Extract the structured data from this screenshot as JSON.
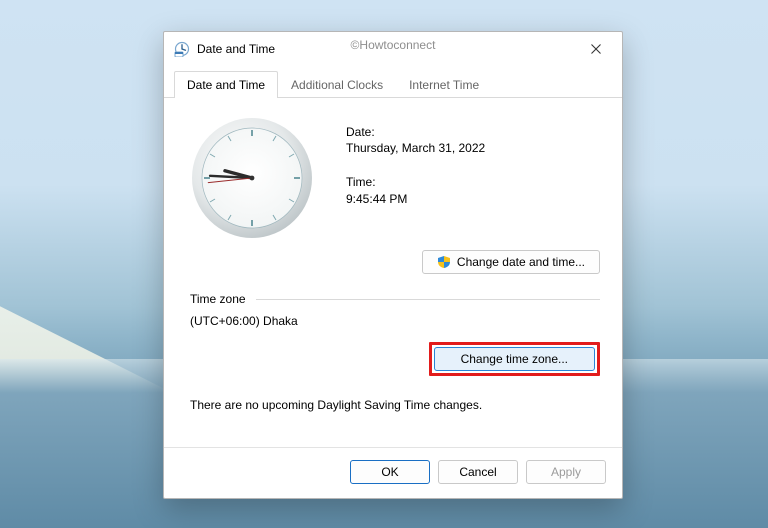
{
  "watermark": "©Howtoconnect",
  "window": {
    "title": "Date and Time"
  },
  "tabs": [
    {
      "label": "Date and Time",
      "active": true
    },
    {
      "label": "Additional Clocks",
      "active": false
    },
    {
      "label": "Internet Time",
      "active": false
    }
  ],
  "datetime": {
    "date_label": "Date:",
    "date_value": "Thursday, March 31, 2022",
    "time_label": "Time:",
    "time_value": "9:45:44 PM",
    "change_button": "Change date and time..."
  },
  "timezone": {
    "group_label": "Time zone",
    "value": "(UTC+06:00) Dhaka",
    "change_button": "Change time zone..."
  },
  "dst_note": "There are no upcoming Daylight Saving Time changes.",
  "footer": {
    "ok": "OK",
    "cancel": "Cancel",
    "apply": "Apply"
  },
  "clock": {
    "hour_angle": 285,
    "minute_angle": 273,
    "second_angle": 264
  }
}
